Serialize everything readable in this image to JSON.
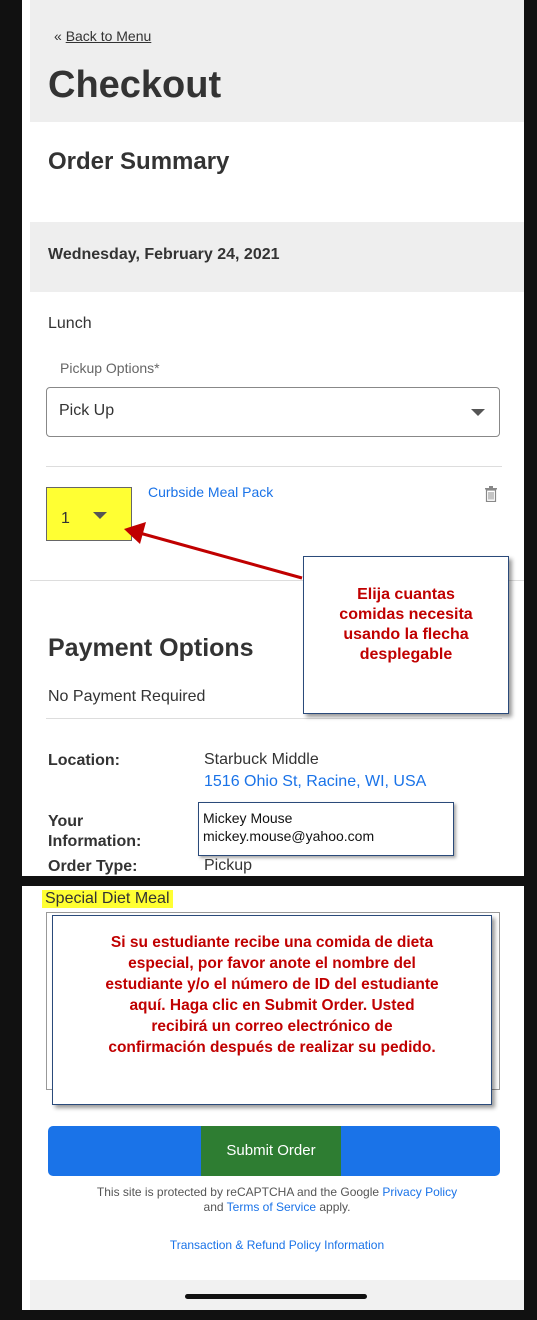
{
  "nav": {
    "back_arrow": "«",
    "back_label": "Back to Menu"
  },
  "page_title": "Checkout",
  "order_summary": {
    "heading": "Order Summary",
    "date": "Wednesday, February 24, 2021",
    "meal": "Lunch",
    "pickup_label": "Pickup Options*",
    "pickup_value": "Pick Up",
    "quantity": "1",
    "item_name": "Curbside Meal Pack"
  },
  "payment": {
    "heading": "Payment Options",
    "status": "No Payment Required"
  },
  "details": {
    "location_label": "Location:",
    "location_name": "Starbuck Middle",
    "location_address": "1516 Ohio St, Racine, WI, USA",
    "info_label_1": "Your",
    "info_label_2": "Information:",
    "info_name": "Mickey Mouse",
    "info_email": "mickey.mouse@yahoo.com",
    "order_type_label": "Order Type:",
    "order_type_value": "Pickup"
  },
  "special_diet": {
    "label": "Special Diet Meal"
  },
  "callouts": {
    "qty_callout": [
      "Elija cuantas",
      "comidas necesita",
      "usando la flecha",
      "desplegable"
    ],
    "diet_callout": [
      "Si su estudiante recibe una comida de dieta",
      "especial, por favor anote el nombre del",
      "estudiante y/o el número de ID del estudiante",
      "aquí. Haga clic en Submit Order. Usted",
      "recibirá un correo electrónico de",
      "confirmación después de realizar su pedido."
    ]
  },
  "submit": {
    "label": "Submit Order"
  },
  "recaptcha": {
    "text_1": "This site is protected by reCAPTCHA and the Google ",
    "privacy_link": "Privacy Policy",
    "text_2": "and ",
    "terms_link": "Terms of Service",
    "text_3": " apply."
  },
  "policy_link": "Transaction & Refund Policy Information",
  "colors": {
    "accent": "#1a73e8",
    "highlight": "#ffff33",
    "callout_text": "#c00000",
    "submit_green": "#2e7d32"
  }
}
